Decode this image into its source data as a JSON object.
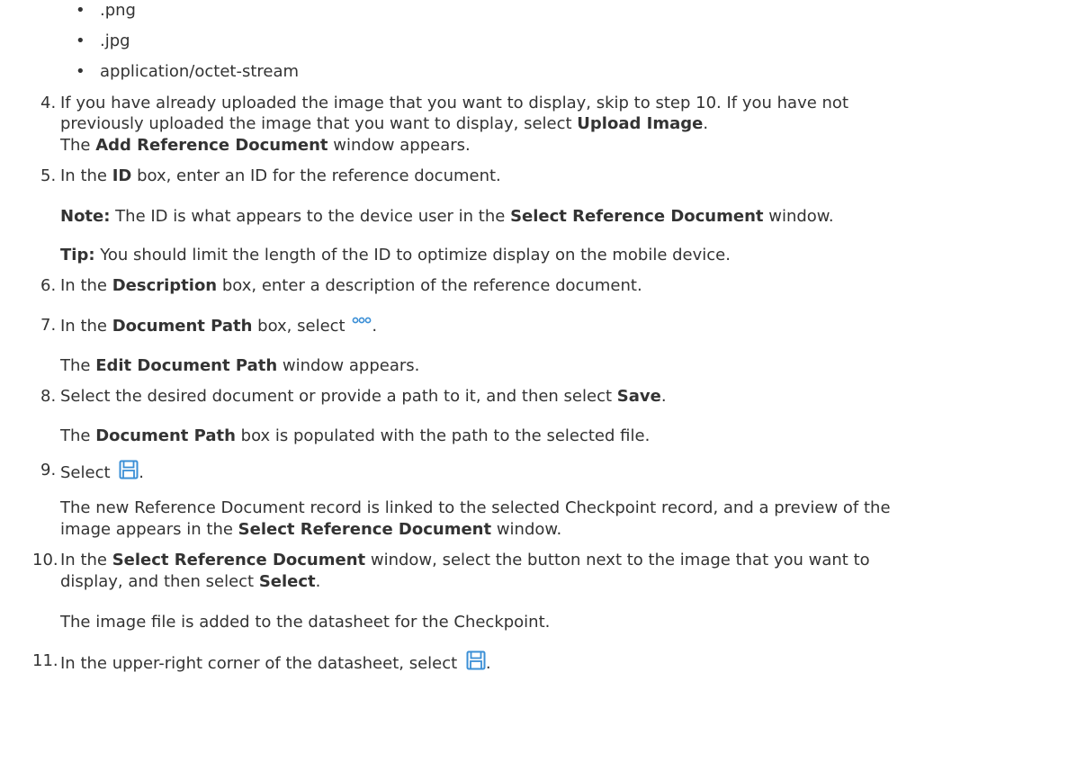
{
  "bullets": [
    ".png",
    ".jpg",
    "application/octet-stream"
  ],
  "step4": {
    "num": "4.",
    "line1": "If you have already uploaded the image that you want to display, skip to step 10. If you have not",
    "line2a": "previously uploaded the image that you want to display, select ",
    "line2b": "Upload Image",
    "line2c": ".",
    "line3a": "The ",
    "line3b": "Add Reference Document",
    "line3c": " window appears."
  },
  "step5": {
    "num": "5.",
    "a": "In the ",
    "b": "ID",
    "c": " box, enter an ID for the reference document.",
    "note_label": "Note:",
    "note_a": " The ID is what appears to the device user in the ",
    "note_b": "Select Reference Document",
    "note_c": " window.",
    "tip_label": "Tip:",
    "tip_text": " You should limit the length of the ID to optimize display on the mobile device."
  },
  "step6": {
    "num": "6.",
    "a": "In the ",
    "b": "Description",
    "c": " box, enter a description of the reference document."
  },
  "step7": {
    "num": "7.",
    "a": "In the ",
    "b": "Document Path",
    "c": " box, select ",
    "d": ".",
    "res_a": "The ",
    "res_b": "Edit Document Path",
    "res_c": " window appears."
  },
  "step8": {
    "num": "8.",
    "a": "Select the desired document or provide a path to it, and then select ",
    "b": "Save",
    "c": ".",
    "res_a": "The ",
    "res_b": "Document Path",
    "res_c": " box is populated with the path to the selected file."
  },
  "step9": {
    "num": "9.",
    "a": "Select ",
    "d": ".",
    "res_line1": "The new Reference Document record is linked to the selected Checkpoint record, and a preview of the",
    "res_line2a": "image appears in the ",
    "res_line2b": "Select Reference Document",
    "res_line2c": " window."
  },
  "step10": {
    "num": "10.",
    "a": "In the ",
    "b": "Select Reference Document",
    "c": " window, select the button next to the image that you want to",
    "line2a": "display, and then select ",
    "line2b": "Select",
    "line2c": ".",
    "res": "The image file is added to the datasheet for the Checkpoint."
  },
  "step11": {
    "num": "11.",
    "a": "In the upper-right corner of the datasheet, select ",
    "d": "."
  },
  "icons": {
    "ellipsis": "ellipsis-icon",
    "save": "save-icon",
    "accent": "#3b8fd6"
  }
}
